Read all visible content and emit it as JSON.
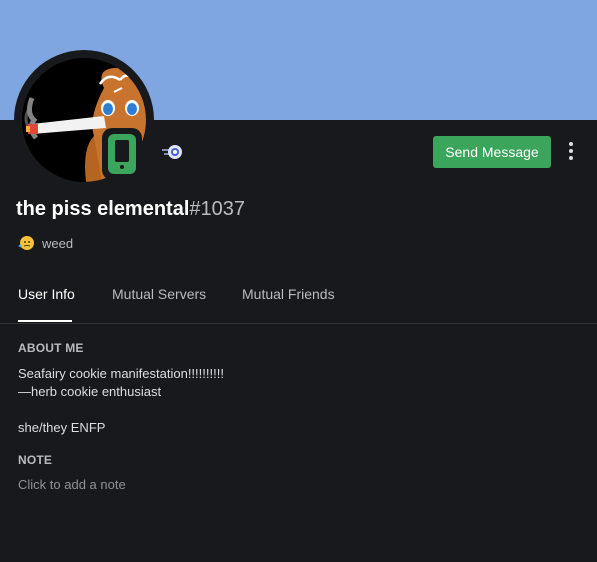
{
  "profile": {
    "username": "the piss elemental",
    "discriminator": "#1037",
    "custom_status_text": "weed",
    "status_emoji": "thinking-sweat-emoji",
    "platform_status": "mobile-online",
    "status_color": "#3ba55c",
    "banner_color": "#7fa6e0"
  },
  "actions": {
    "send_message_label": "Send Message",
    "more_icon": "more-vertical-icon"
  },
  "tabs": [
    {
      "label": "User Info",
      "active": true
    },
    {
      "label": "Mutual Servers",
      "active": false
    },
    {
      "label": "Mutual Friends",
      "active": false
    }
  ],
  "about": {
    "title": "ABOUT ME",
    "text": "Seafairy cookie manifestation!!!!!!!!!!\n—herb cookie enthusiast\n\nshe/they ENFP"
  },
  "note": {
    "title": "NOTE",
    "placeholder": "Click to add a note"
  }
}
